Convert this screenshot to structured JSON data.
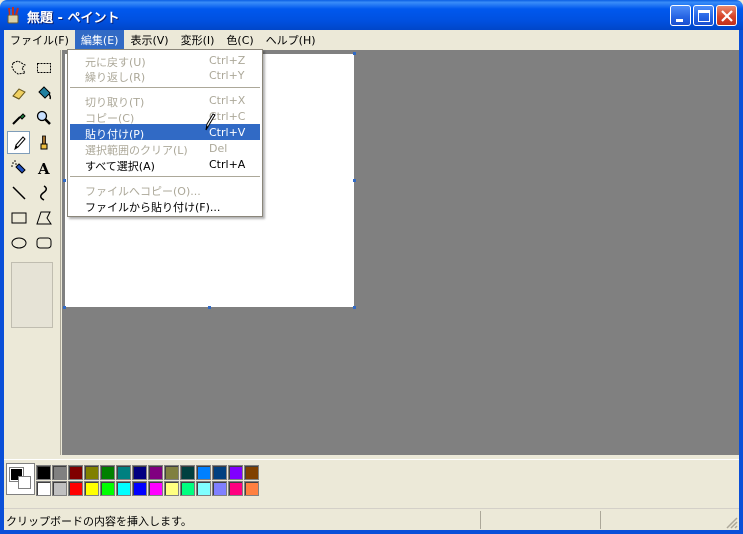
{
  "window": {
    "title": "無題 - ペイント",
    "icon": "paint-brush-app-icon"
  },
  "menubar": {
    "items": [
      {
        "label": "ファイル(F)"
      },
      {
        "label": "編集(E)"
      },
      {
        "label": "表示(V)"
      },
      {
        "label": "変形(I)"
      },
      {
        "label": "色(C)"
      },
      {
        "label": "ヘルプ(H)"
      }
    ]
  },
  "edit_menu": {
    "items": [
      {
        "label": "元に戻す(U)",
        "shortcut": "Ctrl+Z",
        "enabled": false
      },
      {
        "label": "繰り返し(R)",
        "shortcut": "Ctrl+Y",
        "enabled": false
      },
      {
        "label": "切り取り(T)",
        "shortcut": "Ctrl+X",
        "enabled": false
      },
      {
        "label": "コピー(C)",
        "shortcut": "Ctrl+C",
        "enabled": false
      },
      {
        "label": "貼り付け(P)",
        "shortcut": "Ctrl+V",
        "enabled": true
      },
      {
        "label": "選択範囲のクリア(L)",
        "shortcut": "Del",
        "enabled": false
      },
      {
        "label": "すべて選択(A)",
        "shortcut": "Ctrl+A",
        "enabled": true
      },
      {
        "label": "ファイルへコピー(O)...",
        "shortcut": "",
        "enabled": false
      },
      {
        "label": "ファイルから貼り付け(F)...",
        "shortcut": "",
        "enabled": true
      }
    ]
  },
  "tools": [
    "free-select-icon",
    "rect-select-icon",
    "eraser-icon",
    "fill-bucket-icon",
    "color-picker-icon",
    "magnifier-icon",
    "pencil-icon",
    "brush-icon",
    "airbrush-icon",
    "text-icon",
    "line-icon",
    "curve-icon",
    "rectangle-icon",
    "polygon-icon",
    "ellipse-icon",
    "rounded-rect-icon"
  ],
  "selected_tool": "pencil-icon",
  "palette": {
    "foreground": "#000000",
    "background": "#ffffff",
    "row1": [
      "#000000",
      "#808080",
      "#800000",
      "#808000",
      "#008000",
      "#008080",
      "#000080",
      "#800080",
      "#808040",
      "#004040",
      "#0080ff",
      "#004080",
      "#8000ff",
      "#804000"
    ],
    "row2": [
      "#ffffff",
      "#c0c0c0",
      "#ff0000",
      "#ffff00",
      "#00ff00",
      "#00ffff",
      "#0000ff",
      "#ff00ff",
      "#ffff80",
      "#00ff80",
      "#80ffff",
      "#8080ff",
      "#ff0080",
      "#ff8040"
    ]
  },
  "statusbar": {
    "text": "クリップボードの内容を挿入します。"
  }
}
